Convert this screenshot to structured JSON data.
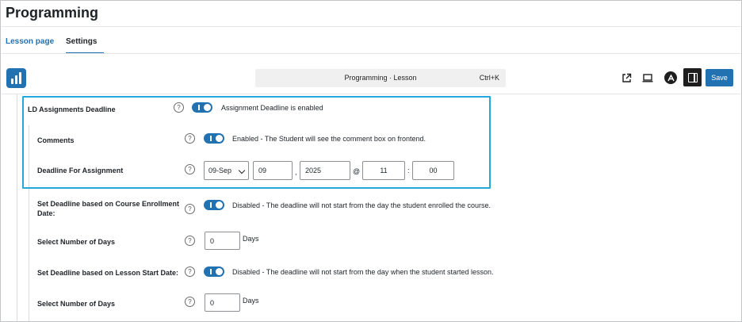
{
  "page": {
    "title": "Programming"
  },
  "tabs": [
    {
      "label": "Lesson page"
    },
    {
      "label": "Settings"
    }
  ],
  "toolbar": {
    "command_title": "Programming · Lesson",
    "command_shortcut": "Ctrl+K",
    "save_label": "Save"
  },
  "settings": {
    "assignments_deadline": {
      "label": "LD Assignments Deadline",
      "status": "Assignment Deadline is enabled",
      "enabled": true
    },
    "comments": {
      "label": "Comments",
      "status": "Enabled - The Student will see the comment box on frontend.",
      "enabled": true
    },
    "deadline": {
      "label": "Deadline For Assignment",
      "month": "09-Sep",
      "day": "09",
      "day_sep": ",",
      "year": "2025",
      "at": "@",
      "hour": "11",
      "time_sep": ":",
      "minute": "00"
    },
    "enrollment_deadline": {
      "label": "Set Deadline based on Course Enrollment Date:",
      "status": "Disabled - The deadline will not start from the day the student enrolled the course.",
      "enabled": true
    },
    "enrollment_days": {
      "label": "Select Number of Days",
      "value": "0",
      "unit": "Days"
    },
    "lesson_start_deadline": {
      "label": "Set Deadline based on Lesson Start Date:",
      "status": "Disabled - The deadline will not start from the day when the student started lesson.",
      "enabled": true
    },
    "lesson_days": {
      "label": "Select Number of Days",
      "value": "0",
      "unit": "Days"
    }
  },
  "help_glyph": "?",
  "colors": {
    "accent": "#2271b1",
    "highlight": "#25a6dd"
  }
}
